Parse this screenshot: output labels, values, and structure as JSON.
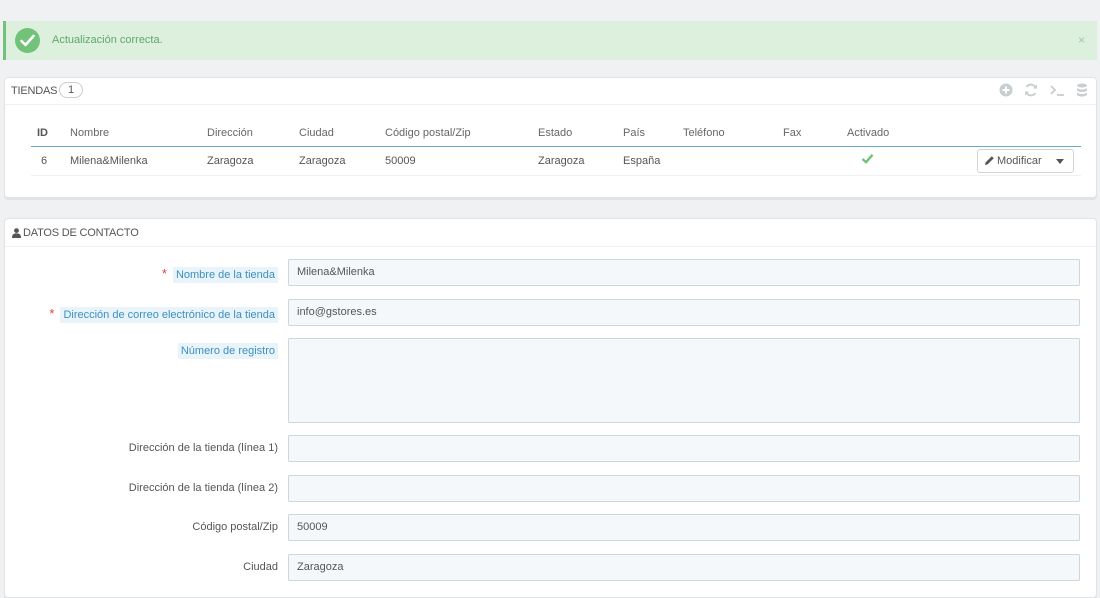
{
  "alert": {
    "message": "Actualización correcta.",
    "close": "×"
  },
  "stores_panel": {
    "title": "TIENDAS",
    "count": "1",
    "columns": [
      "ID",
      "Nombre",
      "Dirección",
      "Ciudad",
      "Código postal/Zip",
      "Estado",
      "País",
      "Teléfono",
      "Fax",
      "Activado"
    ],
    "rows": [
      {
        "id": "6",
        "name": "Milena&Milenka",
        "address": "Zaragoza",
        "city": "Zaragoza",
        "zip": "50009",
        "state": "Zaragoza",
        "country": "España",
        "phone": "",
        "fax": "",
        "active": true
      }
    ],
    "edit_label": "Modificar"
  },
  "contact_panel": {
    "title": "DATOS DE CONTACTO",
    "fields": [
      {
        "label": "Nombre de la tienda",
        "value": "Milena&Milenka",
        "required": true
      },
      {
        "label": "Dirección de correo electrónico de la tienda",
        "value": "info@gstores.es",
        "required": true
      },
      {
        "label": "Número de registro",
        "value": "",
        "required": false
      },
      {
        "label": "Dirección de la tienda (línea 1)",
        "value": "",
        "required": false
      },
      {
        "label": "Dirección de la tienda (línea 2)",
        "value": "",
        "required": false
      },
      {
        "label": "Código postal/Zip",
        "value": "50009",
        "required": false
      },
      {
        "label": "Ciudad",
        "value": "Zaragoza",
        "required": false
      }
    ]
  },
  "colors": {
    "success": "#72c279",
    "accent": "#3c8fc1",
    "required": "#e0413d"
  },
  "icons": [
    "check-circle-icon",
    "close-icon",
    "add-icon",
    "refresh-icon",
    "terminal-icon",
    "database-icon",
    "checkmark-icon",
    "pencil-icon",
    "caret-down-icon",
    "user-icon"
  ]
}
